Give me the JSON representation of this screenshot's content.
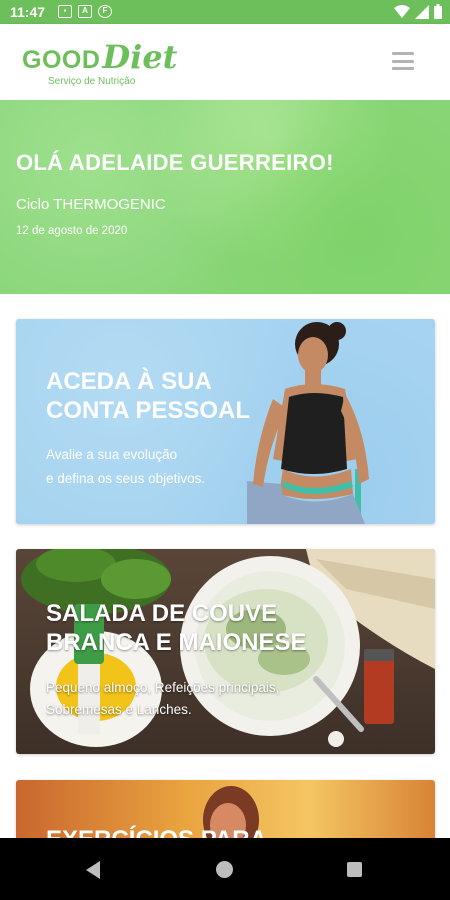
{
  "status": {
    "time": "11:47"
  },
  "app": {
    "logo_good": "GOOD",
    "logo_diet": "Diet",
    "logo_sub": "Serviço de Nutrição"
  },
  "hero": {
    "greeting": "OLÁ ADELAIDE GUERREIRO!",
    "cycle": "Ciclo THERMOGENIC",
    "date": "12 de agosto de 2020"
  },
  "cards": [
    {
      "title_1": "ACEDA À SUA",
      "title_2": "CONTA PESSOAL",
      "desc_1": "Avalie a sua evolução",
      "desc_2": "e defina os seus objetivos."
    },
    {
      "title_1": "SALADA DE COUVE",
      "title_2": "BRANCA E MAIONESE",
      "desc_1": "Pequeno almoço, Refeições principais,",
      "desc_2": "Sobremesas e Lanches."
    },
    {
      "title_1": "EXERCÍCIOS PARA"
    }
  ],
  "icons": {
    "menu": "hamburger-icon",
    "back": "back-icon",
    "home": "home-icon",
    "recent": "recents-icon"
  },
  "colors": {
    "brand": "#6cbf5b",
    "statusbar": "#6cbf5b"
  }
}
